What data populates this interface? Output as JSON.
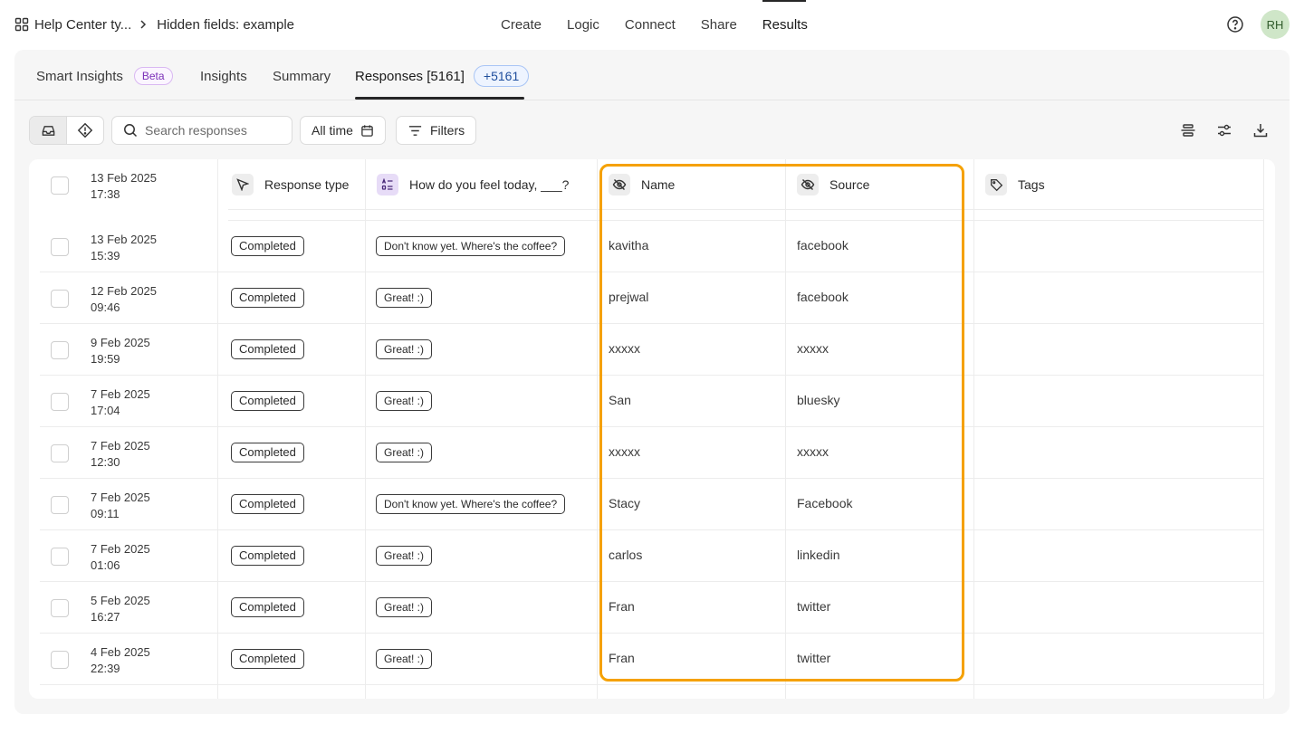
{
  "breadcrumb": {
    "workspace": "Help Center ty...",
    "form": "Hidden fields: example"
  },
  "topnav": [
    "Create",
    "Logic",
    "Connect",
    "Share",
    "Results"
  ],
  "topnav_active": "Results",
  "user": {
    "initials": "RH"
  },
  "tabs": {
    "smart_insights": "Smart Insights",
    "beta": "Beta",
    "insights": "Insights",
    "summary": "Summary",
    "responses": "Responses [5161]",
    "new_count": "+5161"
  },
  "toolbar": {
    "search_placeholder": "Search responses",
    "time_filter": "All time",
    "filters": "Filters"
  },
  "table": {
    "columns": {
      "response_type": "Response type",
      "question": "How do you feel today, ___?",
      "name": "Name",
      "source": "Source",
      "tags": "Tags"
    },
    "header_date": {
      "date": "13 Feb 2025",
      "time": "17:38"
    },
    "rows": [
      {
        "date": "13 Feb 2025",
        "time": "15:39",
        "type": "Completed",
        "answer": "Don't know yet. Where's the coffee?",
        "name": "kavitha",
        "source": "facebook"
      },
      {
        "date": "12 Feb 2025",
        "time": "09:46",
        "type": "Completed",
        "answer": "Great! :)",
        "name": "prejwal",
        "source": "facebook"
      },
      {
        "date": "9 Feb 2025",
        "time": "19:59",
        "type": "Completed",
        "answer": "Great! :)",
        "name": "xxxxx",
        "source": "xxxxx"
      },
      {
        "date": "7 Feb 2025",
        "time": "17:04",
        "type": "Completed",
        "answer": "Great! :)",
        "name": "San",
        "source": "bluesky"
      },
      {
        "date": "7 Feb 2025",
        "time": "12:30",
        "type": "Completed",
        "answer": "Great! :)",
        "name": "xxxxx",
        "source": "xxxxx"
      },
      {
        "date": "7 Feb 2025",
        "time": "09:11",
        "type": "Completed",
        "answer": "Don't know yet. Where's the coffee?",
        "name": "Stacy",
        "source": "Facebook"
      },
      {
        "date": "7 Feb 2025",
        "time": "01:06",
        "type": "Completed",
        "answer": "Great! :)",
        "name": "carlos",
        "source": "linkedin"
      },
      {
        "date": "5 Feb 2025",
        "time": "16:27",
        "type": "Completed",
        "answer": "Great! :)",
        "name": "Fran",
        "source": "twitter"
      },
      {
        "date": "4 Feb 2025",
        "time": "22:39",
        "type": "Completed",
        "answer": "Great! :)",
        "name": "Fran",
        "source": "twitter"
      }
    ]
  },
  "colors": {
    "highlight": "#f5a100",
    "beta": "#7b2fb8",
    "new_badge": "#1f4e9c"
  }
}
